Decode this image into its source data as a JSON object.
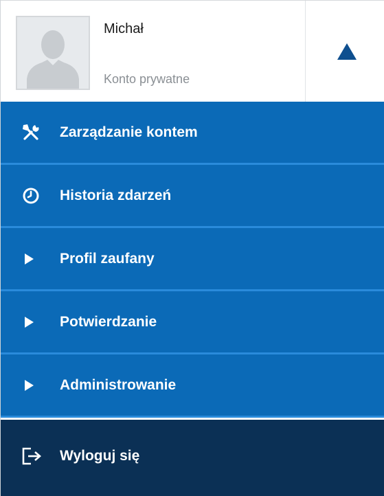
{
  "user": {
    "name": "Michał",
    "account_type": "Konto prywatne"
  },
  "menu": {
    "items": [
      {
        "label": "Zarządzanie kontem",
        "icon": "tools-icon"
      },
      {
        "label": "Historia zdarzeń",
        "icon": "clock-icon"
      },
      {
        "label": "Profil zaufany",
        "icon": "play-icon"
      },
      {
        "label": "Potwierdzanie",
        "icon": "play-icon"
      },
      {
        "label": "Administrowanie",
        "icon": "play-icon"
      }
    ],
    "logout": {
      "label": "Wyloguj się",
      "icon": "logout-icon"
    }
  },
  "colors": {
    "menu_blue": "#0b6ab7",
    "separator": "#2a8bdb",
    "logout_bg": "#0b3055",
    "toggle_arrow": "#0e4f8f"
  }
}
